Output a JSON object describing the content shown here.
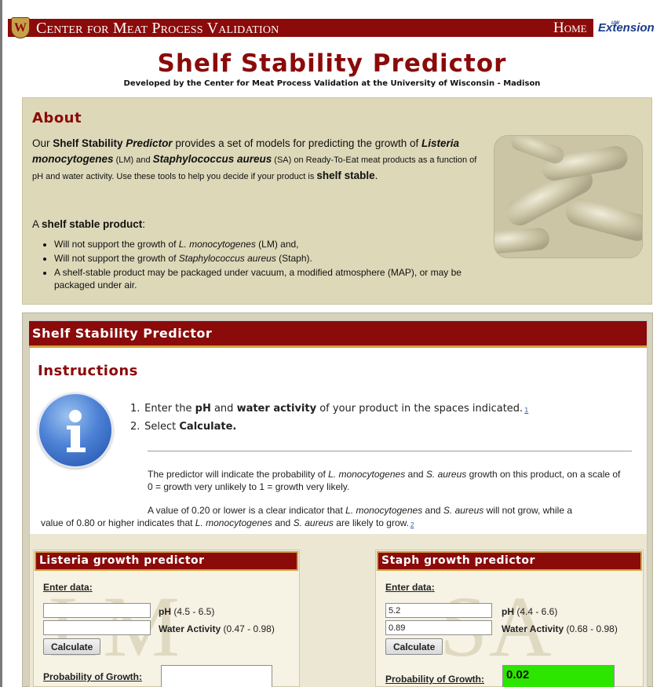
{
  "header": {
    "crest_letter": "W",
    "site_title": "Center for Meat Process Validation",
    "home_label": "Home",
    "extension_logo": "Extension",
    "extension_logo_small": "UW"
  },
  "page": {
    "title": "Shelf Stability Predictor",
    "subtitle": "Developed by the Center for Meat Process Validation at the University of Wisconsin - Madison"
  },
  "about": {
    "heading": "About",
    "p1": "Our ",
    "p2": "Shelf Stability ",
    "p3": "Predictor",
    "p4": " provides a set of models for predicting the growth of ",
    "p5": "Listeria monocytogenes",
    "p6": " (LM) and ",
    "p7": "Staphylococcus aureus",
    "p8": " (SA) on Ready-To-Eat meat products as a function of pH and water activity. Use these tools to help you decide if your product is ",
    "p9": "shelf stable",
    "p10": ".",
    "shelf_a": "A ",
    "shelf_b": "shelf stable product",
    "shelf_c": ":",
    "bullet1_a": "Will not support the growth of ",
    "bullet1_b": "L. monocytogenes",
    "bullet1_c": " (LM) and,",
    "bullet2_a": "Will not support the growth of ",
    "bullet2_b": "Staphylococcus aureus",
    "bullet2_c": " (Staph).",
    "bullet3": "A shelf-stable product may be packaged under vacuum, a modified atmosphere (MAP), or may be packaged under air."
  },
  "predictor": {
    "heading": "Shelf Stability Predictor",
    "instructions_title": "Instructions",
    "step1_num": "1.",
    "step1_a": "Enter the ",
    "step1_b": "pH",
    "step1_c": " and ",
    "step1_d": "water activity",
    "step1_e": " of your product in the spaces indicated.",
    "step1_ref": "1",
    "step2_num": "2.",
    "step2_a": "Select ",
    "step2_b": "Calculate.",
    "note1_a": "The predictor will indicate the probability of ",
    "note1_b": "L. monocytogenes",
    "note1_c": " and ",
    "note1_d": "S. aureus",
    "note1_e": " growth on this product, on a scale of 0 = growth very unlikely to 1 = growth very likely.",
    "note2_a": "A value of 0.20 or lower is a clear indicator that ",
    "note2_b": "L. monocytogenes",
    "note2_c": " and ",
    "note2_d": "S. aureus",
    "note2_e": " will not grow, while a",
    "note3_a": "value of 0.80 or higher indicates that ",
    "note3_b": "L. monocytogenes",
    "note3_c": " and ",
    "note3_d": "S. aureus",
    "note3_e": " are likely to grow.",
    "note3_ref": "2"
  },
  "listeria": {
    "heading": "Listeria growth predictor",
    "watermark": "LM",
    "enter_label": "Enter data",
    "colon": ":",
    "ph_value": "",
    "aw_value": "",
    "ph_label": "pH",
    "ph_range": " (4.5 - 6.5)",
    "aw_label": "Water Activity",
    "aw_range": " (0.47 - 0.98)",
    "calculate": "Calculate",
    "prob_label": "Probability of Growth",
    "prob_value": ""
  },
  "staph": {
    "heading": "Staph growth predictor",
    "watermark": "SA",
    "enter_label": "Enter data",
    "colon": ":",
    "ph_value": "5.2",
    "aw_value": "0.89",
    "ph_label": "pH",
    "ph_range": " (4.4 - 6.6)",
    "aw_label": "Water Activity",
    "aw_range": " (0.68 - 0.98)",
    "calculate": "Calculate",
    "prob_label": "Probability of Growth",
    "prob_value": "0.02"
  },
  "colors": {
    "brand_red": "#8b0a0a",
    "gold": "#d1a23a",
    "about_bg": "#ddd8b8",
    "result_green": "#2de600"
  }
}
